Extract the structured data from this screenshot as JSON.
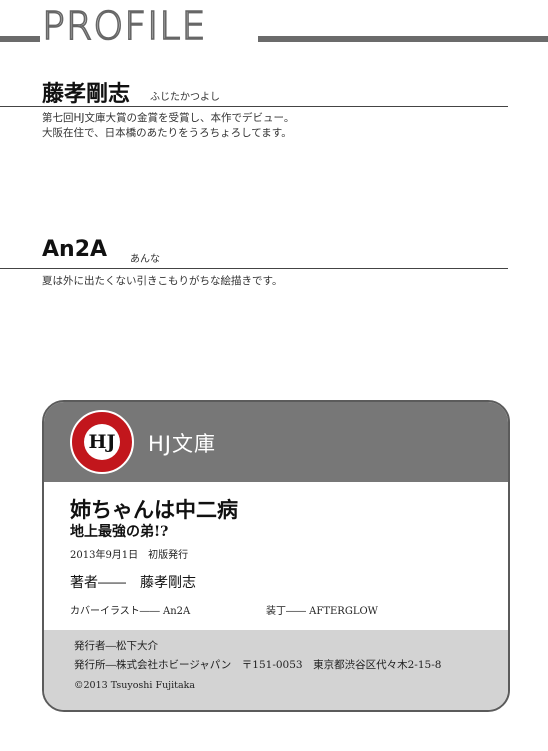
{
  "header": {
    "title": "PROFILE"
  },
  "author": {
    "name": "藤孝剛志",
    "reading": "ふじたかつよし",
    "bio_line1": "第七回HJ文庫大賞の金賞を受賞し、本作でデビュー。",
    "bio_line2": "大阪在住で、日本橋のあたりをうろちょろしてます。"
  },
  "illustrator": {
    "name": "An2A",
    "reading": "あんな",
    "bio_line1": "夏は外に出たくない引きこもりがちな絵描きです。"
  },
  "colophon": {
    "brand": "HJ文庫",
    "logo_text": "HJ",
    "book_title": "姉ちゃんは中二病",
    "subtitle": "地上最強の弟!?",
    "date_line": "2013年9月1日　初版発行",
    "author_label": "著者――　藤孝剛志",
    "cover_illust": "カバーイラスト―― An2A",
    "design": "装丁―― AFTERGLOW",
    "publisher_person": "発行者―松下大介",
    "publisher_company": "発行所―株式会社ホビージャパン　〒151-0053　東京都渋谷区代々木2-15-8",
    "copyright": "©2013 Tsuyoshi Fujitaka"
  },
  "colors": {
    "gray_band": "#777777",
    "logo_red": "#c2161c",
    "foot_band": "#d3d3d3"
  }
}
